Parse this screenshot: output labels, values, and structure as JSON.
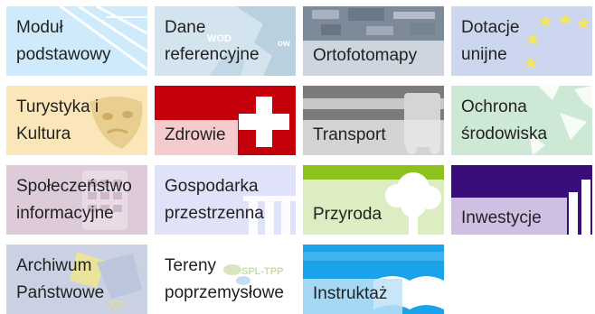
{
  "tiles": [
    {
      "id": "modul-podstawowy",
      "lines": [
        "Moduł",
        "podstawowy"
      ],
      "bg": "#bfe3f8",
      "deco": "lines"
    },
    {
      "id": "dane-referencyjne",
      "lines": [
        "Dane",
        "referencyjne"
      ],
      "bg": "#c9dcea",
      "deco": "map",
      "watermark": [
        "WOD",
        "ow"
      ]
    },
    {
      "id": "ortofotomapy",
      "lines": [
        "Ortofotomapy"
      ],
      "bg": "#9ea9b8",
      "deco": "photo"
    },
    {
      "id": "dotacje-unijne",
      "lines": [
        "Dotacje",
        "unijne"
      ],
      "bg": "#cdd6ee",
      "deco": "stars"
    },
    {
      "id": "turystyka-i-kultura",
      "lines": [
        "Turystyka i",
        "Kultura"
      ],
      "bg": "#f9e6b8",
      "deco": "mask"
    },
    {
      "id": "zdrowie",
      "lines": [
        "Zdrowie"
      ],
      "bg": "#c4000b",
      "deco": "cross"
    },
    {
      "id": "transport",
      "lines": [
        "Transport"
      ],
      "bg": "#7a7a7a",
      "deco": "bus"
    },
    {
      "id": "ochrona-srodowiska",
      "lines": [
        "Ochrona",
        "środowiska"
      ],
      "bg": "#c8e6d3",
      "deco": "leaves"
    },
    {
      "id": "spoleczenstwo-informacyjne",
      "lines": [
        "Społeczeństwo",
        "informacyjne"
      ],
      "bg": "#dcc9d8",
      "deco": "phone"
    },
    {
      "id": "gospodarka-przestrzenna",
      "lines": [
        "Gospodarka",
        "przestrzenna"
      ],
      "bg": "#dde0f7",
      "deco": "pillars"
    },
    {
      "id": "przyroda",
      "lines": [
        "Przyroda"
      ],
      "bg": "#8cc21e",
      "deco": "tree"
    },
    {
      "id": "inwestycje",
      "lines": [
        "Inwestycje"
      ],
      "bg": "#3a0e7a",
      "deco": "chart"
    },
    {
      "id": "archiwum-panstwowe",
      "lines": [
        "Archiwum",
        "Państwowe"
      ],
      "bg": "#c7cfe2",
      "deco": "xp"
    },
    {
      "id": "tereny-poprzemyslowe",
      "lines": [
        "Tereny",
        "poprzemysłowe"
      ],
      "bg": "#ffffff",
      "deco": "tpp",
      "watermark": [
        "SPL-TPP"
      ]
    },
    {
      "id": "instruktaz",
      "lines": [
        "Instruktaż"
      ],
      "bg": "#1aa3e8",
      "deco": "book"
    }
  ]
}
